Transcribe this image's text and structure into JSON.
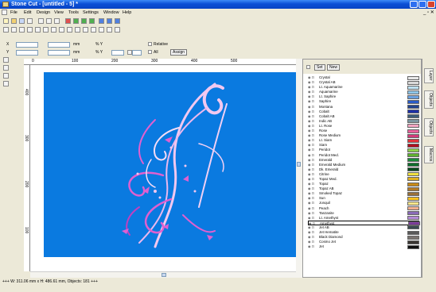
{
  "window": {
    "title": "Stone Cut - [untitled - 5] *"
  },
  "menu": [
    {
      "label": "File"
    },
    {
      "label": "Edit"
    },
    {
      "label": "Design"
    },
    {
      "label": "View"
    },
    {
      "label": "Tools"
    },
    {
      "label": "Settings"
    },
    {
      "label": "Window"
    },
    {
      "label": "Help"
    }
  ],
  "fields": {
    "x_label": "X",
    "y_label": "Y",
    "unit_mm": "mm",
    "unit_pct": "% Y",
    "relative_label": "Relative",
    "all_label": "All",
    "assign_label": "Assign"
  },
  "ruler_top": [
    "0",
    "100",
    "200",
    "300",
    "400",
    "500"
  ],
  "ruler_left": [
    "400",
    "300",
    "200",
    "100"
  ],
  "panel": {
    "set_label": "Set",
    "new_label": "New"
  },
  "colors": [
    {
      "name": "Crystal",
      "color": "#e8e8e8"
    },
    {
      "name": "Crystal AB",
      "color": "#d9d9d9"
    },
    {
      "name": "Lt. Aquamarine",
      "color": "#bde1f2"
    },
    {
      "name": "Aquamarine",
      "color": "#8ec5e8"
    },
    {
      "name": "Lt. Saphire",
      "color": "#6aa0e0"
    },
    {
      "name": "Saphire",
      "color": "#2a5cc8"
    },
    {
      "name": "Montana",
      "color": "#23448f"
    },
    {
      "name": "Cobalt",
      "color": "#1c2fa8"
    },
    {
      "name": "Cobalt AB",
      "color": "#3e5e7a"
    },
    {
      "name": "Indic AB",
      "color": "#7b95a0"
    },
    {
      "name": "Lt. Rose",
      "color": "#f4a6c2"
    },
    {
      "name": "Rose",
      "color": "#e8609a"
    },
    {
      "name": "Rose Medium",
      "color": "#d43a7a"
    },
    {
      "name": "Lt. Siam",
      "color": "#e2323a"
    },
    {
      "name": "Siam",
      "color": "#b01020"
    },
    {
      "name": "Peridot",
      "color": "#8ed04a"
    },
    {
      "name": "Peridot Med.",
      "color": "#5fb030"
    },
    {
      "name": "Emerald",
      "color": "#1a8a3a"
    },
    {
      "name": "Emerald Medium",
      "color": "#0f6e2c"
    },
    {
      "name": "Dk. Emerald",
      "color": "#0a4a1e"
    },
    {
      "name": "Citrine",
      "color": "#f0e040"
    },
    {
      "name": "Topaz Med.",
      "color": "#e0b020"
    },
    {
      "name": "Topaz",
      "color": "#c88a18"
    },
    {
      "name": "Topaz AB",
      "color": "#b27a28"
    },
    {
      "name": "Smoked Topaz",
      "color": "#9a7038"
    },
    {
      "name": "Sun",
      "color": "#f8c020"
    },
    {
      "name": "Jonquil",
      "color": "#f8e68a"
    },
    {
      "name": "Peach",
      "color": "#f2b090"
    },
    {
      "name": "Tanzanite",
      "color": "#8a6ab8"
    },
    {
      "name": "Lt. Amethyst",
      "color": "#b48ad8"
    },
    {
      "name": "Amethyst",
      "color": "#7a3a98"
    },
    {
      "name": "Jet AB",
      "color": "#3a4a50"
    },
    {
      "name": "Jet Hematite",
      "color": "#5a5a5a"
    },
    {
      "name": "Black Diamond",
      "color": "#7a7470"
    },
    {
      "name": "Cosmo Jet",
      "color": "#3a3632"
    },
    {
      "name": "Jet",
      "color": "#101010"
    }
  ],
  "selected_color_index": 30,
  "side_tabs": [
    "Layer",
    "Objects",
    "Objects",
    "Macros"
  ],
  "status": {
    "text": "+++ W: 311.06 mm x H: 486.61 mm, Objects: 181 +++"
  },
  "theme": {
    "design_bg": "#0a7ae0",
    "swirl_light": "#f2c8f0",
    "swirl_pink": "#e060d0"
  }
}
